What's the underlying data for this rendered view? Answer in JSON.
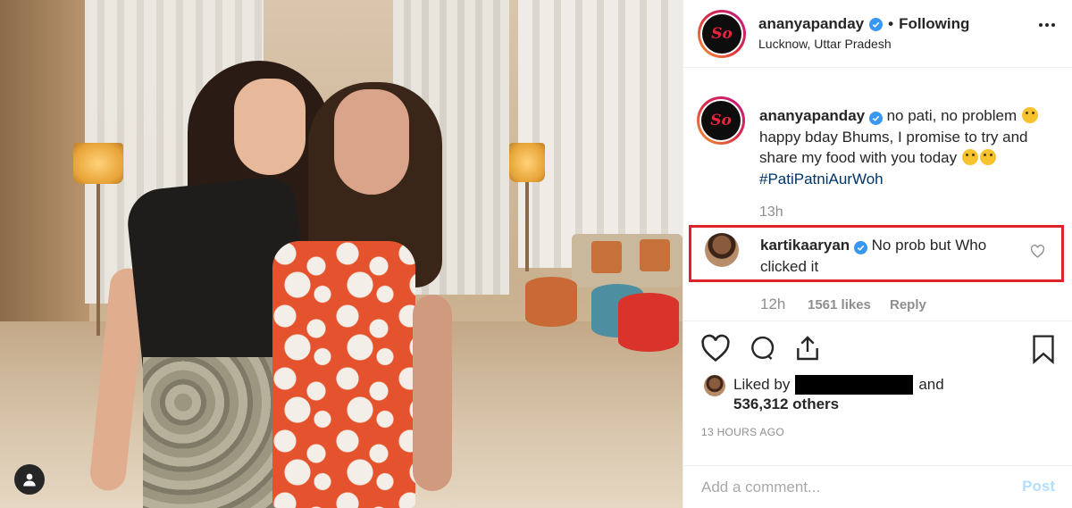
{
  "header": {
    "username": "ananyapanday",
    "separator": "•",
    "follow_status": "Following",
    "location": "Lucknow, Uttar Pradesh",
    "avatar_logo_text": "So"
  },
  "caption": {
    "username": "ananyapanday",
    "text_part1": "no pati, no problem",
    "text_part2": "happy bday Bhums, I promise to try and share my food with you today",
    "hashtag": "#PatiPatniAurWoh",
    "time": "13h"
  },
  "comment": {
    "username": "kartikaaryan",
    "text": "No prob but Who clicked it",
    "time": "12h",
    "likes": "1561 likes",
    "reply_label": "Reply"
  },
  "likes": {
    "prefix": "Liked by",
    "and": "and",
    "others": "536,312 others"
  },
  "timestamp": "13 HOURS AGO",
  "add_comment": {
    "placeholder": "Add a comment...",
    "post_label": "Post"
  },
  "icons": {
    "like": "heart-icon",
    "comment": "comment-bubble-icon",
    "share": "share-icon",
    "save": "bookmark-icon",
    "more": "more-options-icon",
    "verified": "verified-badge-icon",
    "tag": "user-tag-icon"
  },
  "colors": {
    "verified": "#3897f0",
    "highlight_box": "#e0212e",
    "hashtag": "#003569",
    "muted": "#8e8e8e",
    "post_disabled": "#b2dffc"
  }
}
